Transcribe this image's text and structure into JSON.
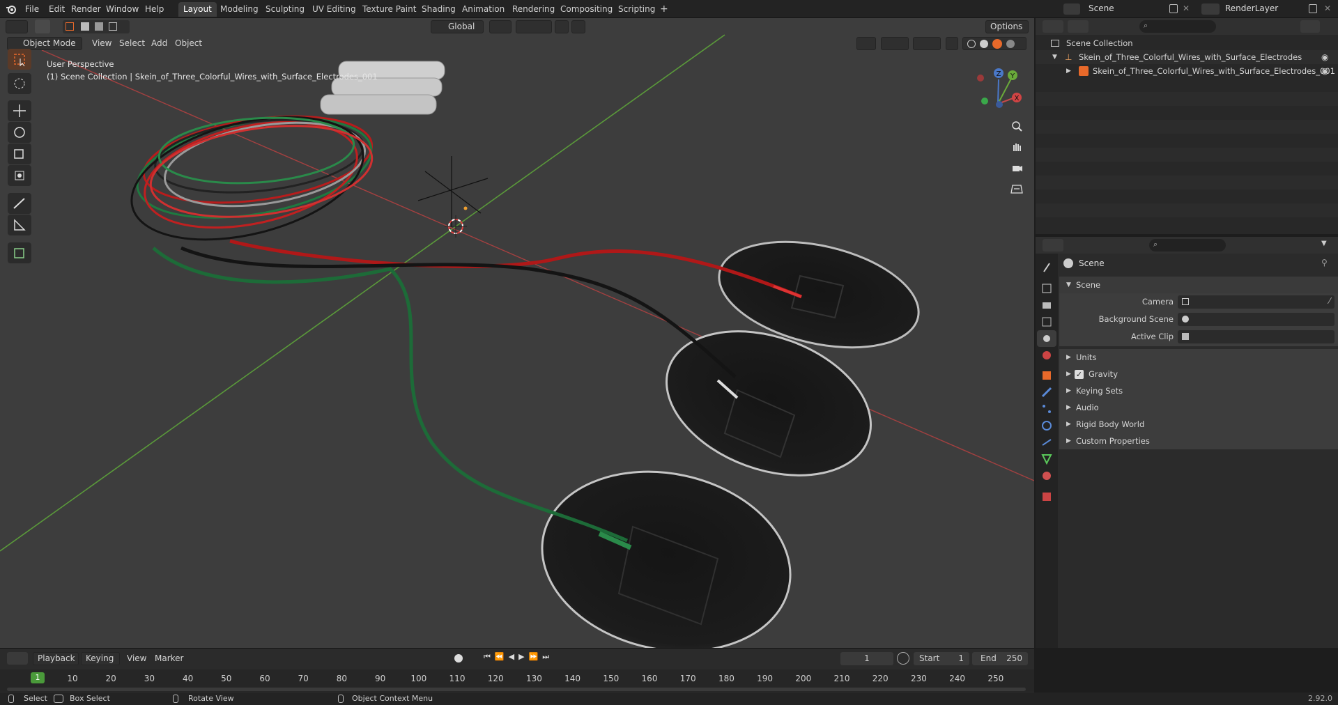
{
  "menubar": {
    "items": [
      "File",
      "Edit",
      "Render",
      "Window",
      "Help"
    ],
    "workspaces": [
      "Layout",
      "Modeling",
      "Sculpting",
      "UV Editing",
      "Texture Paint",
      "Shading",
      "Animation",
      "Rendering",
      "Compositing",
      "Scripting"
    ],
    "active_workspace": "Layout",
    "add_tab": "+",
    "scene_name": "Scene",
    "render_layer": "RenderLayer"
  },
  "viewport": {
    "mode": "Object Mode",
    "menu": [
      "View",
      "Select",
      "Add",
      "Object"
    ],
    "transform_orientation": "Global",
    "options": "Options",
    "overlay_title": "User Perspective",
    "overlay_subtitle": "(1) Scene Collection | Skein_of_Three_Colorful_Wires_with_Surface_Electrodes_001",
    "gizmo_labels": {
      "z": "Z",
      "y": "Y",
      "x": "X"
    }
  },
  "outliner": {
    "root": "Scene Collection",
    "items": [
      {
        "label": "Skein_of_Three_Colorful_Wires_with_Surface_Electrodes",
        "level": 1
      },
      {
        "label": "Skein_of_Three_Colorful_Wires_with_Surface_Electrodes_001",
        "level": 2
      }
    ]
  },
  "properties": {
    "context": "Scene",
    "panel": "Scene",
    "fields": [
      {
        "label": "Camera",
        "value": ""
      },
      {
        "label": "Background Scene",
        "value": ""
      },
      {
        "label": "Active Clip",
        "value": ""
      }
    ],
    "subpanels": [
      "Units",
      "Gravity",
      "Keying Sets",
      "Audio",
      "Rigid Body World",
      "Custom Properties"
    ],
    "gravity_checked": true
  },
  "timeline": {
    "menu": [
      "Playback",
      "Keying",
      "View",
      "Marker"
    ],
    "current_frame": "1",
    "start_label": "Start",
    "start": "1",
    "end_label": "End",
    "end": "250",
    "ticks": [
      "10",
      "20",
      "30",
      "40",
      "50",
      "60",
      "70",
      "80",
      "90",
      "100",
      "110",
      "120",
      "130",
      "140",
      "150",
      "160",
      "170",
      "180",
      "190",
      "200",
      "210",
      "220",
      "230",
      "240",
      "250"
    ],
    "frame_marker": "1"
  },
  "statusbar": {
    "select": "Select",
    "box_select": "Box Select",
    "rotate_view": "Rotate View",
    "context_menu": "Object Context Menu",
    "version": "2.92.0"
  },
  "colors": {
    "accent": "#e8692a",
    "viewport_bg": "#3d3d3d",
    "active_tab": "#4772b3"
  }
}
